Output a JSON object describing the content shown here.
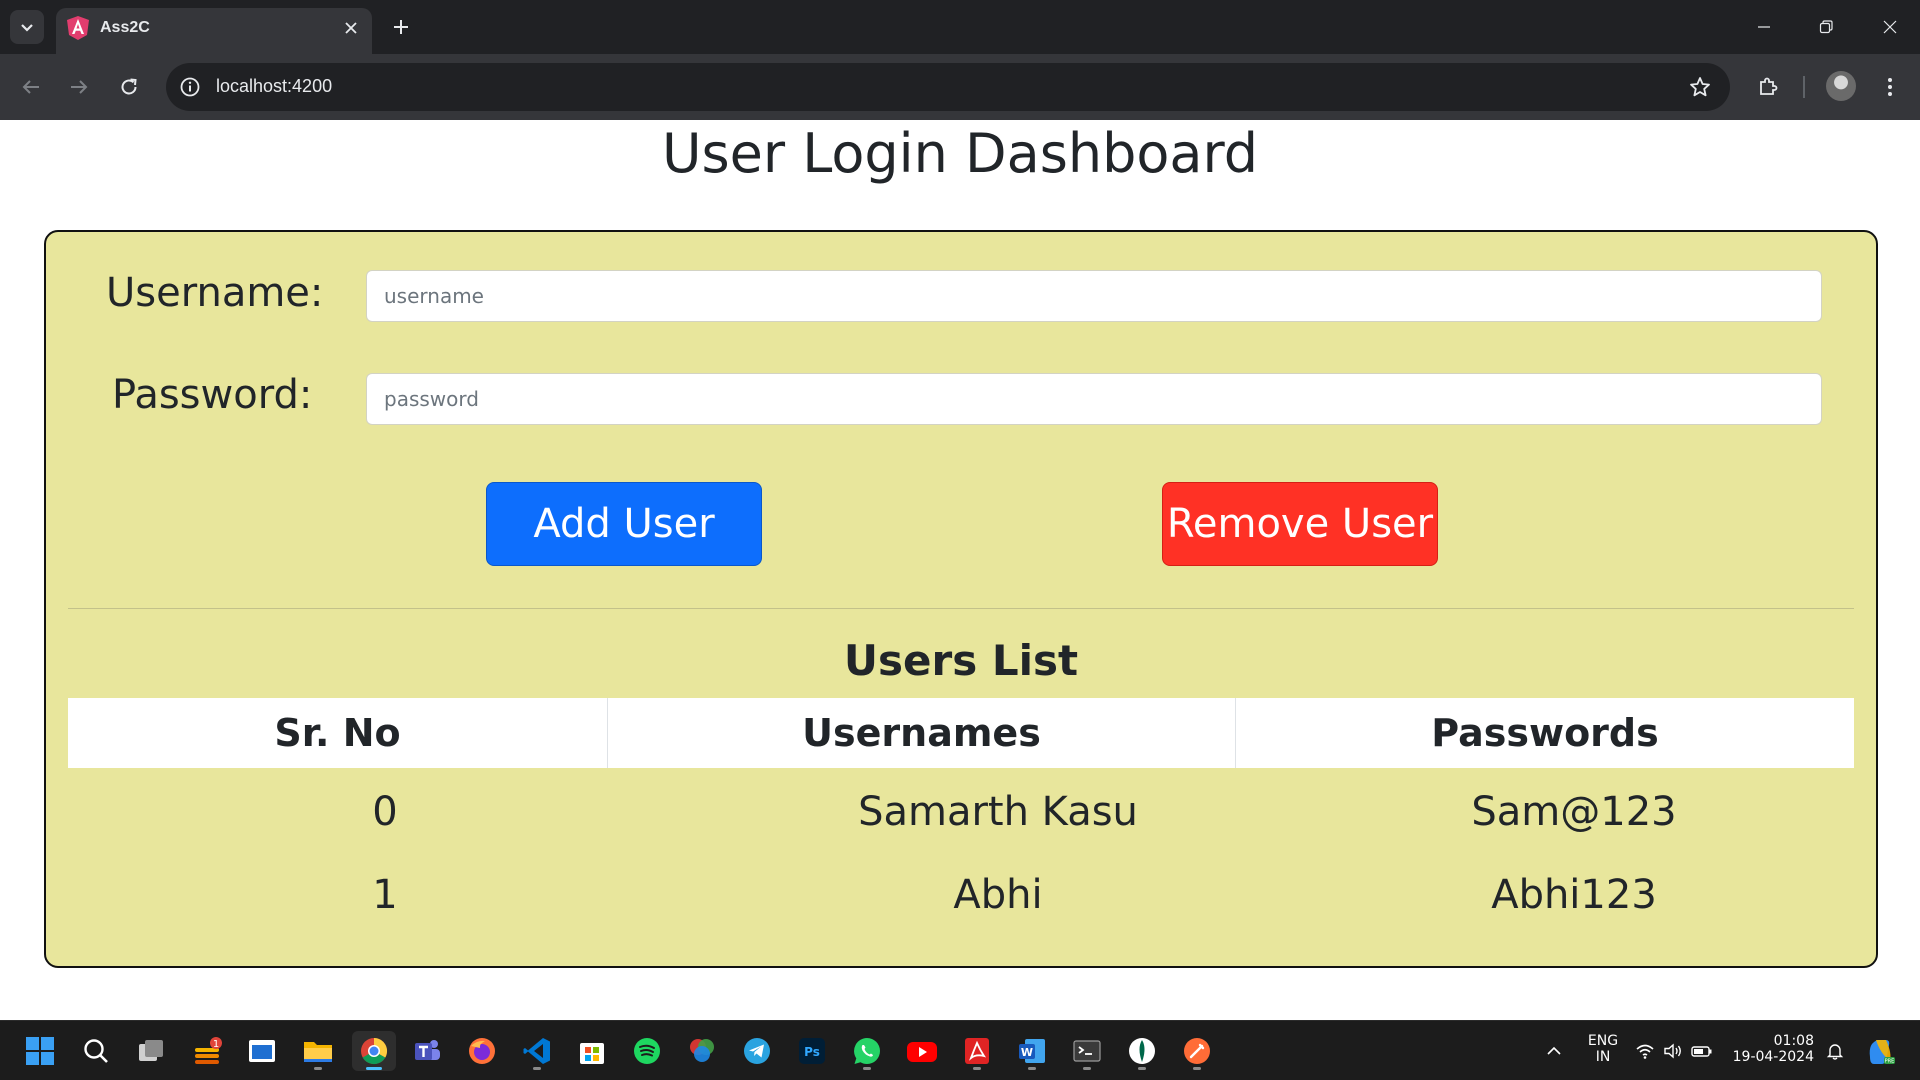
{
  "browser": {
    "tab_title": "Ass2C",
    "url": "localhost:4200"
  },
  "page": {
    "title": "User Login Dashboard",
    "form": {
      "username_label": "Username:",
      "username_placeholder": "username",
      "password_label": "Password:",
      "password_placeholder": "password",
      "add_button": "Add User",
      "remove_button": "Remove User"
    },
    "list": {
      "title": "Users List",
      "columns": [
        "Sr. No",
        "Usernames",
        "Passwords"
      ],
      "rows": [
        [
          "0",
          "Samarth Kasu",
          "Sam@123"
        ],
        [
          "1",
          "Abhi",
          "Abhi123"
        ]
      ]
    }
  },
  "taskbar": {
    "apps": [
      "start-icon",
      "search-icon",
      "task-view-icon",
      "widgets-icon",
      "dev-home-icon",
      "file-explorer-icon",
      "chrome-icon",
      "teams-icon",
      "firefox-icon",
      "vscode-icon",
      "store-icon",
      "spotify-icon",
      "davinci-icon",
      "telegram-icon",
      "photoshop-icon",
      "whatsapp-icon",
      "youtube-icon",
      "acrobat-icon",
      "word-icon",
      "terminal-icon",
      "mongodb-compass-icon",
      "postman-icon"
    ],
    "widgets_badge": "1",
    "lang_line1": "ENG",
    "lang_line2": "IN",
    "time": "01:08",
    "date": "19-04-2024"
  },
  "colors": {
    "card_bg": "#e8e69c",
    "add_button": "#0d6efd",
    "remove_button": "#ff3125"
  }
}
